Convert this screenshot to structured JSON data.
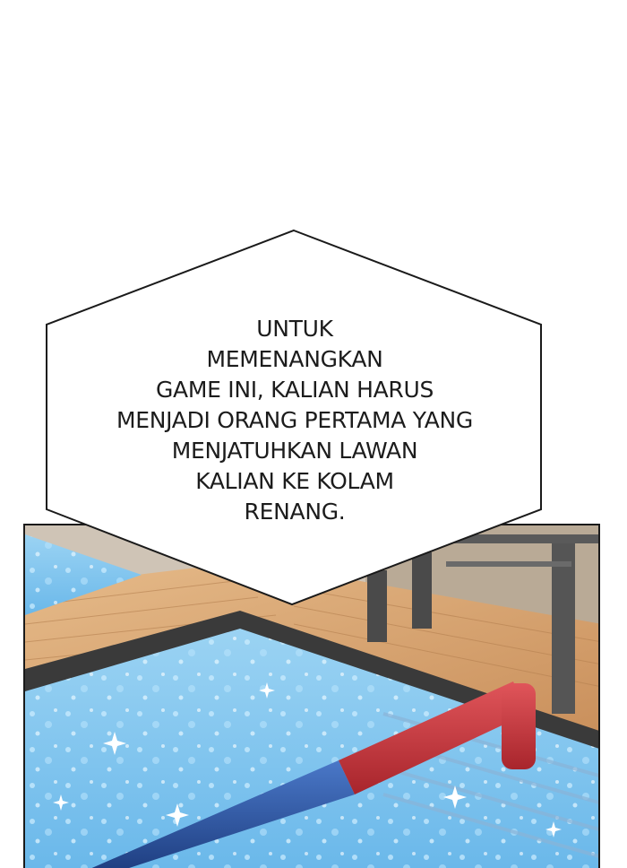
{
  "speech_bubble": {
    "lines": [
      "UNTUK",
      "MEMENANGKAN",
      "GAME INI, KALIAN HARUS",
      "MENJADI ORANG PERTAMA YANG",
      "MENJATUHKAN LAWAN",
      "KALIAN KE KOLAM",
      "RENANG."
    ]
  },
  "colors": {
    "water": "#7fc6f0",
    "deck": "#d9a974",
    "pipe_blue": "#2f5aa8",
    "pipe_red": "#c9383e"
  }
}
